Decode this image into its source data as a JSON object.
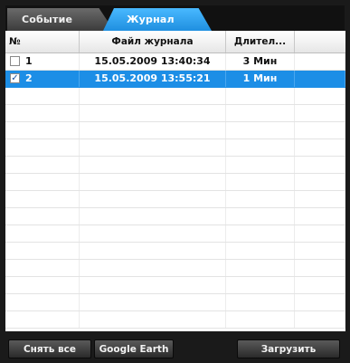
{
  "tabs": [
    {
      "label": "Событие",
      "active": false
    },
    {
      "label": "Журнал",
      "active": true
    }
  ],
  "table": {
    "headers": [
      "№",
      "Файл журнала",
      "Длител..."
    ],
    "rows": [
      {
        "checked": false,
        "no": "1",
        "file": "15.05.2009 13:40:34",
        "duration": "3 Мин",
        "selected": false
      },
      {
        "checked": true,
        "no": "2",
        "file": "15.05.2009 13:55:21",
        "duration": "1 Мин",
        "selected": true
      }
    ]
  },
  "buttons": {
    "clear_all": "Снять все",
    "google_earth": "Google Earth",
    "load": "Загрузить"
  },
  "colors": {
    "active_tab": "#1f8fe0",
    "selection": "#1c8ee6",
    "background": "#1a1a1a"
  }
}
